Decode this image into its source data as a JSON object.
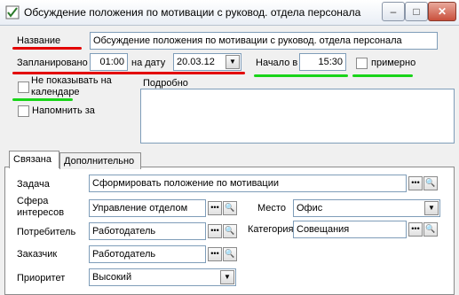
{
  "window": {
    "title": "Обсуждение положения по мотивации с руковод. отдела персонала",
    "min": "–",
    "max": "□",
    "close": "✕"
  },
  "form": {
    "name_label": "Название",
    "name_value": "Обсуждение положения по мотивации с руковод. отдела персонала",
    "planned_label": "Запланировано",
    "planned_value": "01:00",
    "date_label": "на дату",
    "date_value": "20.03.12",
    "start_label": "Начало в",
    "start_value": "15:30",
    "approx_label": "примерно",
    "nocal_label": "Не показывать на календаре",
    "details_label": "Подробно",
    "remind_label": "Напомнить за"
  },
  "tabs": [
    "Связана",
    "Дополнительно"
  ],
  "linked": {
    "task_label": "Задача",
    "task_value": "Сформировать положение по мотивации",
    "sphere_label": "Сфера интересов",
    "sphere_value": "Управление отделом",
    "place_label": "Место",
    "place_value": "Офис",
    "consumer_label": "Потребитель",
    "consumer_value": "Работодатель",
    "category_label": "Категория",
    "category_value": "Совещания",
    "customer_label": "Заказчик",
    "customer_value": "Работодатель",
    "priority_label": "Приоритет",
    "priority_value": "Высокий"
  },
  "icons": {
    "more": "•••",
    "search": "🔍",
    "dropdown": "▼"
  },
  "colors": {
    "red_mark": "#e30000",
    "green_mark": "#19d419"
  }
}
